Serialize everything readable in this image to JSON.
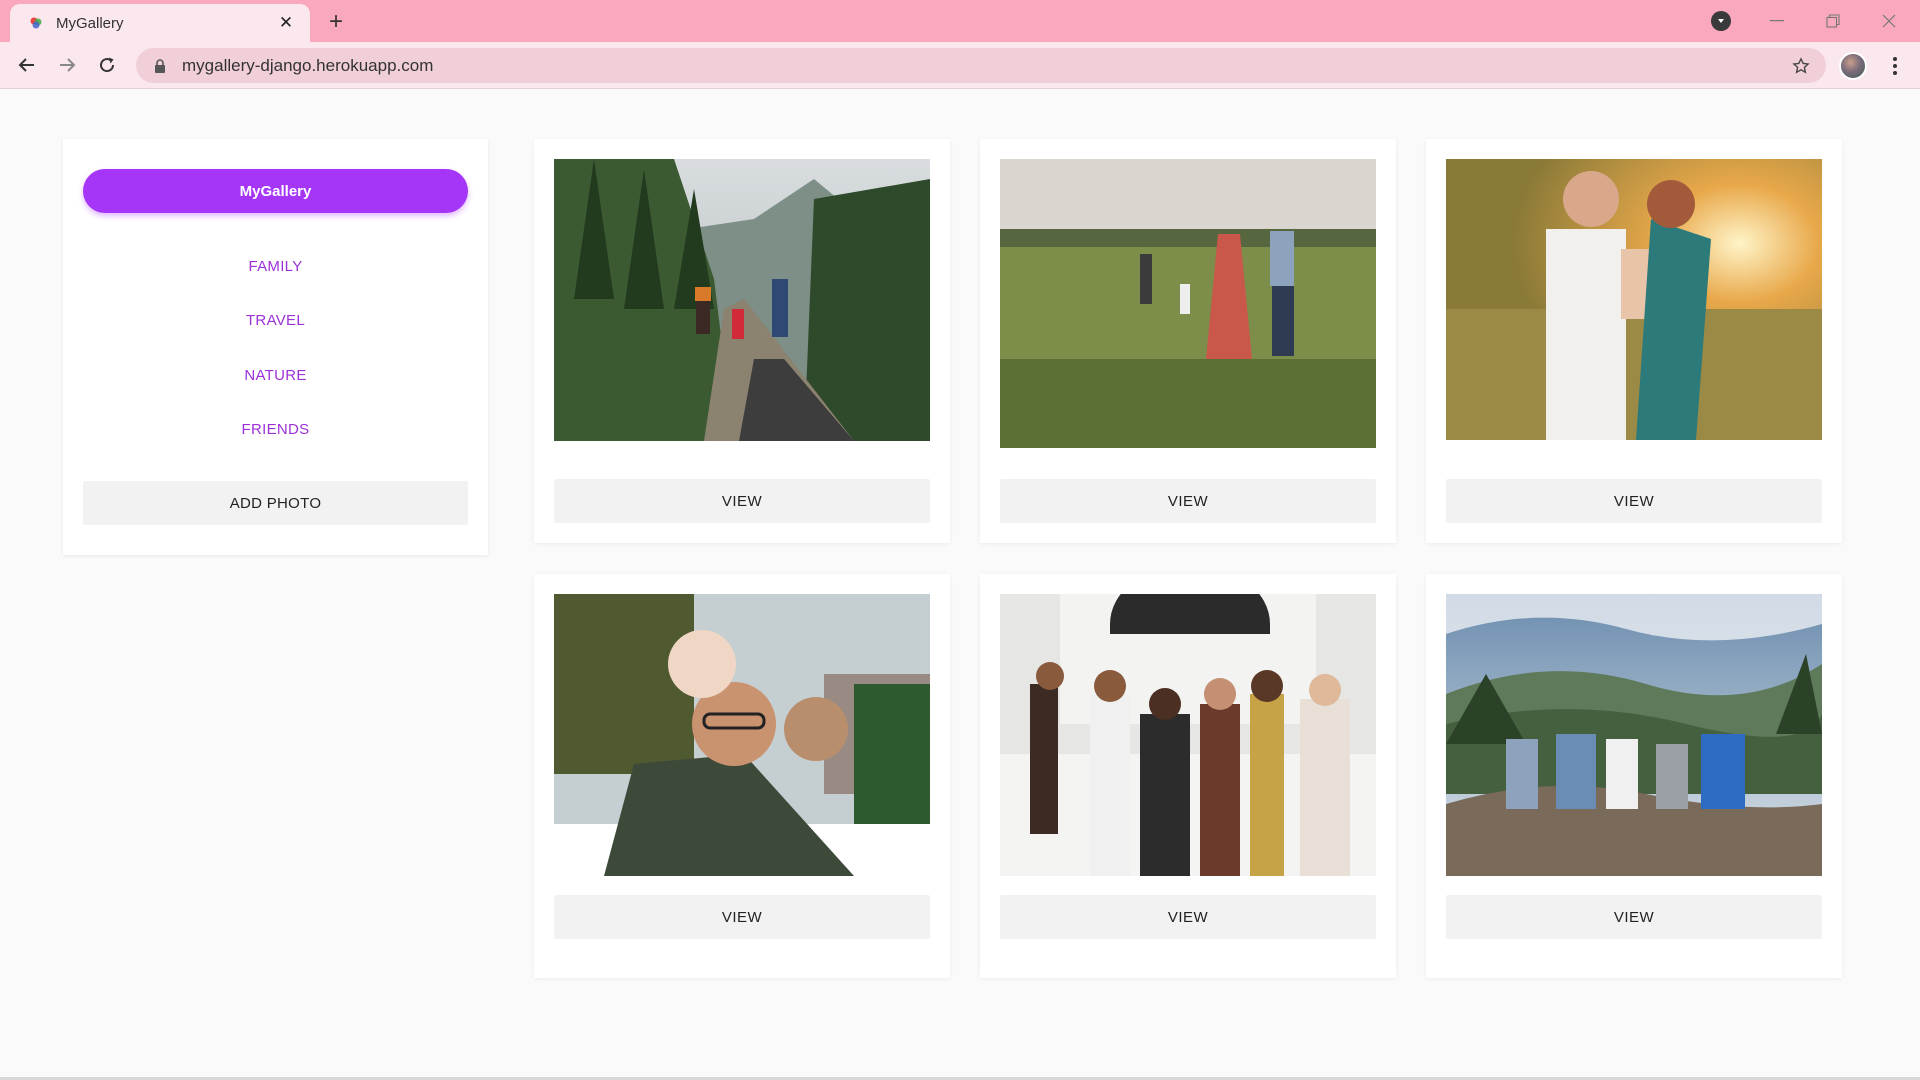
{
  "browser": {
    "tab_title": "MyGallery",
    "url": "mygallery-django.herokuapp.com",
    "icons": {
      "back": "back-arrow-icon",
      "forward": "forward-arrow-icon",
      "reload": "reload-icon",
      "lock": "lock-icon",
      "bookmark": "star-icon",
      "menu": "kebab-menu-icon"
    }
  },
  "sidebar": {
    "brand": "MyGallery",
    "categories": [
      "FAMILY",
      "TRAVEL",
      "NATURE",
      "FRIENDS"
    ],
    "add_photo_label": "ADD PHOTO"
  },
  "gallery": {
    "view_label": "VIEW",
    "photos": [
      {
        "scene": "family walking on mountain trail"
      },
      {
        "scene": "family holding hands in grassy field"
      },
      {
        "scene": "parents holding baby at sunset"
      },
      {
        "scene": "father carrying two children"
      },
      {
        "scene": "large family group portrait"
      },
      {
        "scene": "friends sitting on rock overlooking mountains"
      }
    ]
  },
  "colors": {
    "accent": "#a535f7",
    "link": "#9c31d8",
    "tabbar": "#f9a8bd",
    "toolbar": "#fbe7ee"
  }
}
